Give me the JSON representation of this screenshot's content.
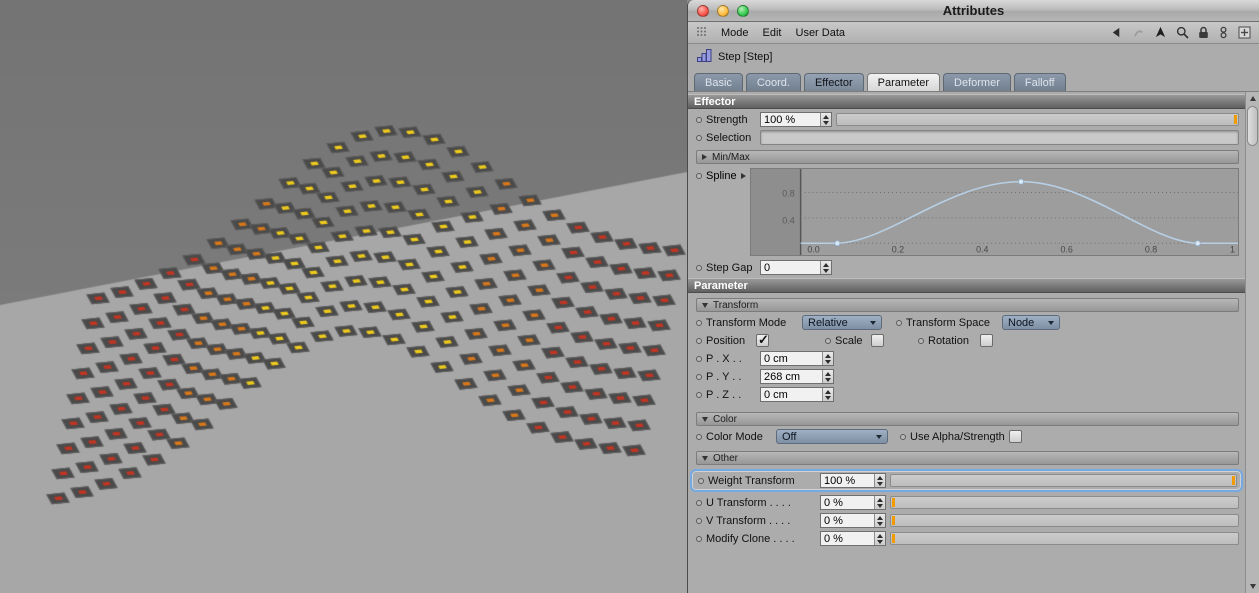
{
  "window": {
    "title": "Attributes"
  },
  "menubar": {
    "items": [
      "Mode",
      "Edit",
      "User Data"
    ]
  },
  "object_row": {
    "label": "Step [Step]"
  },
  "tabs": [
    {
      "label": "Basic",
      "state": "normal"
    },
    {
      "label": "Coord.",
      "state": "normal"
    },
    {
      "label": "Effector",
      "state": "selected"
    },
    {
      "label": "Parameter",
      "state": "active"
    },
    {
      "label": "Deformer",
      "state": "normal"
    },
    {
      "label": "Falloff",
      "state": "normal"
    }
  ],
  "effector": {
    "header": "Effector",
    "strength": {
      "label": "Strength",
      "value": "100 %",
      "slider_percent": 100
    },
    "selection": {
      "label": "Selection",
      "value": ""
    },
    "minmax": {
      "label": "Min/Max"
    },
    "spline": {
      "label": "Spline",
      "y_ticks": [
        "0.8",
        "0.4"
      ],
      "x_ticks": [
        "0.0",
        "0.2",
        "0.4",
        "0.6",
        "0.8",
        "1"
      ],
      "curve_points": [
        [
          0.08,
          0.0
        ],
        [
          0.5,
          0.97
        ],
        [
          0.9,
          0.0
        ]
      ]
    },
    "step_gap": {
      "label": "Step Gap",
      "value": "0"
    }
  },
  "parameter": {
    "header": "Parameter",
    "transform": {
      "header": "Transform"
    },
    "transform_mode": {
      "label": "Transform Mode",
      "value": "Relative"
    },
    "transform_space": {
      "label": "Transform Space",
      "value": "Node"
    },
    "position": {
      "label": "Position",
      "checked": true
    },
    "scale": {
      "label": "Scale",
      "checked": false
    },
    "rotation": {
      "label": "Rotation",
      "checked": false
    },
    "p_x": {
      "label": "P . X . .",
      "value": "0 cm"
    },
    "p_y": {
      "label": "P . Y . .",
      "value": "268 cm"
    },
    "p_z": {
      "label": "P . Z . .",
      "value": "0 cm"
    },
    "color": {
      "header": "Color"
    },
    "color_mode": {
      "label": "Color Mode",
      "value": "Off"
    },
    "use_alpha": {
      "label": "Use Alpha/Strength",
      "checked": false
    },
    "other": {
      "header": "Other"
    },
    "weight_transform": {
      "label": "Weight Transform",
      "value": "100 %",
      "slider_percent": 100
    },
    "u_transform": {
      "label": "U Transform . . . .",
      "value": "0 %",
      "slider_percent": 0
    },
    "v_transform": {
      "label": "V Transform . . . .",
      "value": "0 %",
      "slider_percent": 0
    },
    "modify_clone": {
      "label": "Modify Clone . . . .",
      "value": "0 %",
      "slider_percent": 0
    }
  },
  "viewport": {
    "background_top": "#747474",
    "background": "#828282",
    "floor": "#a7a7a7",
    "tile_color": "#4a4a4a",
    "tile_edge": "#5e5e5e",
    "dot_colors": {
      "low": "#c23522",
      "mid": "#d8781a",
      "high": "#eecb1d"
    },
    "grid": {
      "cols": 25,
      "rows": 9
    },
    "amplitude": 150
  }
}
